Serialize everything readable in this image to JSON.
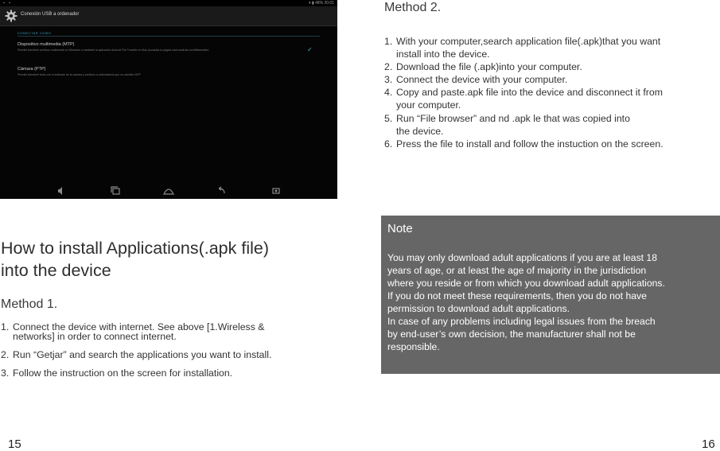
{
  "screenshot": {
    "status_left": "▪ ▪",
    "status_right": "▾ ▮ 48% 20:01",
    "title": "Conexión USB a ordenador",
    "section_header": "CONECTAR COMO",
    "options": [
      {
        "title": "Dispositivo multimedia (MTP)",
        "description": "Permite transferir archivos multimedia en Windows o mediante la aplicación Android File Transfer en Mac (consulta la página www.android.com/filetransfer)",
        "checked": true
      },
      {
        "title": "Cámara (PTP)",
        "description": "Permite transferir fotos con el software de la cámara y archivos a ordenadores que no admiten MTP",
        "checked": false
      }
    ],
    "nav_icons": [
      "volume-icon",
      "recents-icon",
      "home-icon",
      "back-icon",
      "screenshot-icon"
    ]
  },
  "left": {
    "heading_line1": "How to install Applications(.apk file)",
    "heading_line2": "into the device",
    "method_title": "Method 1.",
    "steps": [
      {
        "num": "1.",
        "line1": "Connect the device with internet. See above [1.Wireless &",
        "line2": "networks] in order to connect internet."
      },
      {
        "num": "2.",
        "line1": "Run “Getjar” and search the applications you want to install.",
        "line2": ""
      },
      {
        "num": "3.",
        "line1": "Follow the instruction on the screen for installation.",
        "line2": ""
      }
    ],
    "page_number": "15"
  },
  "right": {
    "method_title": "Method 2.",
    "steps": [
      {
        "num": "1.",
        "line1": "With your computer,search application file(.apk)that you want",
        "line2": "install into the device."
      },
      {
        "num": "2.",
        "line1": "Download the file (.apk)into your computer.",
        "line2": ""
      },
      {
        "num": "3.",
        "line1": "Connect the device with your computer.",
        "line2": ""
      },
      {
        "num": "4.",
        "line1": "Copy and paste.apk file into the device and disconnect it from",
        "line2": "your computer."
      },
      {
        "num": "5.",
        "line1": "Run “File browser” and  nd .apk  le that was copied into",
        "line2": "the device."
      },
      {
        "num": "6.",
        "line1": "Press the file to install and follow the instuction on the screen.",
        "line2": ""
      }
    ],
    "note": {
      "title": "Note",
      "lines": [
        "You may only download adult applications if you are at least 18",
        "years of age, or at least the age of majority in the jurisdiction",
        "where you reside or from which you download adult applications.",
        "If you do not meet these requirements, then you do not have",
        "permission to download adult applications.",
        "In case of any problems including legal issues from the breach",
        "by end-user’s own decision, the manufacturer shall not be",
        "responsible."
      ]
    },
    "page_number": "16"
  },
  "colors": {
    "note_background": "#666666",
    "screen_background": "#050505",
    "accent": "#3aa7c8"
  }
}
